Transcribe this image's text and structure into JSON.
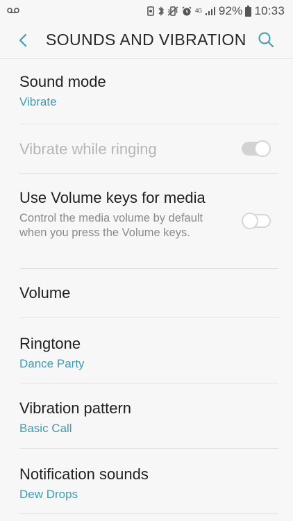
{
  "status_bar": {
    "network": "4G",
    "battery": "92%",
    "time": "10:33"
  },
  "header": {
    "title": "SOUNDS AND VIBRATION",
    "back_icon": "chevron-left-icon",
    "search_icon": "search-icon"
  },
  "settings": {
    "sound_mode": {
      "label": "Sound mode",
      "value": "Vibrate"
    },
    "vibrate_while_ringing": {
      "label": "Vibrate while ringing",
      "enabled": false,
      "toggle_on": true
    },
    "volume_keys_media": {
      "label": "Use Volume keys for media",
      "description": "Control the media volume by default when you press the Volume keys.",
      "toggle_on": false
    },
    "volume": {
      "label": "Volume"
    },
    "ringtone": {
      "label": "Ringtone",
      "value": "Dance Party"
    },
    "vibration_pattern": {
      "label": "Vibration pattern",
      "value": "Basic Call"
    },
    "notification_sounds": {
      "label": "Notification sounds",
      "value": "Dew Drops"
    }
  },
  "colors": {
    "accent": "#3f9bb0",
    "background": "#f7f7f7",
    "disabled_text": "#b6b6b6"
  }
}
